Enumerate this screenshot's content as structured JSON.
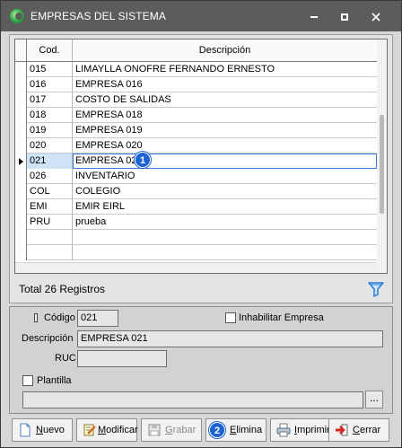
{
  "window": {
    "title": "EMPRESAS DEL SISTEMA",
    "controls": {
      "minimize": "minimize-icon",
      "maximize": "maximize-icon",
      "close": "close-icon"
    }
  },
  "grid": {
    "columns": {
      "code": "Cod.",
      "description": "Descripción"
    },
    "rows": [
      {
        "code": "015",
        "description": "LIMAYLLA ONOFRE FERNANDO ERNESTO"
      },
      {
        "code": "016",
        "description": "EMPRESA 016"
      },
      {
        "code": "017",
        "description": "COSTO DE SALIDAS"
      },
      {
        "code": "018",
        "description": "EMPRESA 018"
      },
      {
        "code": "019",
        "description": "EMPRESA 019"
      },
      {
        "code": "020",
        "description": "EMPRESA 020"
      },
      {
        "code": "021",
        "description": "EMPRESA 021"
      },
      {
        "code": "026",
        "description": "INVENTARIO"
      },
      {
        "code": "COL",
        "description": "COLEGIO"
      },
      {
        "code": "EMI",
        "description": "EMIR EIRL"
      },
      {
        "code": "PRU",
        "description": "prueba"
      },
      {
        "code": "",
        "description": ""
      },
      {
        "code": "",
        "description": ""
      }
    ],
    "selected_row": 6,
    "total_label": "Total 26 Registros",
    "badge": "1"
  },
  "details": {
    "code_label": "Código",
    "code_value": "021",
    "disable_label": "Inhabilitar Empresa",
    "disable_checked": false,
    "description_label": "Descripción",
    "description_value": "EMPRESA 021",
    "ruc_label": "RUC",
    "ruc_value": "",
    "template_label": "Plantilla",
    "template_checked": false,
    "template_value": "",
    "browse_label": "..."
  },
  "buttons": {
    "nuevo_pre": "",
    "nuevo_u": "N",
    "nuevo_post": "uevo",
    "modificar_pre": "",
    "modificar_u": "M",
    "modificar_post": "odificar",
    "grabar_pre": "",
    "grabar_u": "G",
    "grabar_post": "rabar",
    "elimina_pre": "",
    "elimina_u": "E",
    "elimina_post": "limina",
    "imprimir_pre": "",
    "imprimir_u": "I",
    "imprimir_post": "mprimir",
    "cerrar_pre": "",
    "cerrar_u": "C",
    "cerrar_post": "errar",
    "badge": "2"
  },
  "colors": {
    "titlebar": "#5c5c5c",
    "selection_border": "#3d7bd4",
    "badge": "#1e63d6"
  }
}
